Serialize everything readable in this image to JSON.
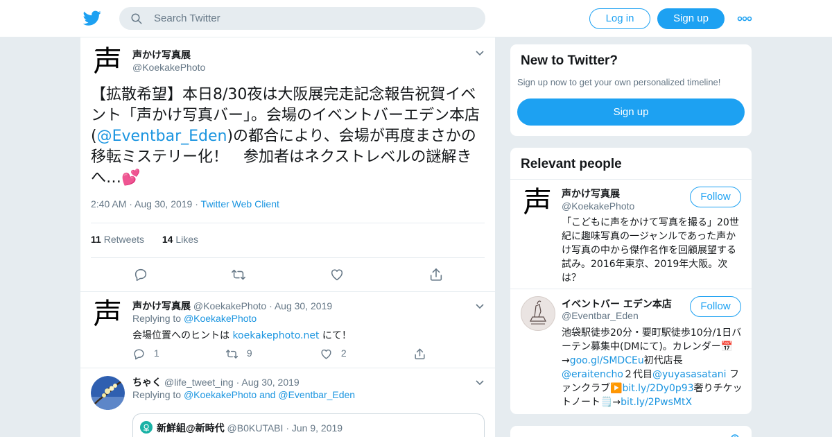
{
  "header": {
    "search_placeholder": "Search Twitter",
    "login_label": "Log in",
    "signup_label": "Sign up"
  },
  "main_tweet": {
    "name": "声かけ写真展",
    "handle": "@KoekakePhoto",
    "avatar_glyph": "声",
    "text_a": "【拡散希望】本日8/30夜は大阪展完走記念報告祝賀イベント「声かけ写真バー」。会場のイベントバーエデン本店(",
    "mention": "@Eventbar_Eden",
    "text_b": ")の都合により、会場が再度まさかの移転ミステリー化！　参加者はネクストレベルの謎解きへ…💕",
    "time": "2:40 AM",
    "date": "Aug 30, 2019",
    "client": "Twitter Web Client",
    "retweets_count": "11",
    "retweets_label": "Retweets",
    "likes_count": "14",
    "likes_label": "Likes"
  },
  "reply1": {
    "name": "声かけ写真展",
    "handle": "@KoekakePhoto",
    "date": "Aug 30, 2019",
    "avatar_glyph": "声",
    "replying_label": "Replying to",
    "replying_to": "@KoekakePhoto",
    "text_a": "会場位置へのヒントは ",
    "link": "koekakephoto.net",
    "text_b": " にて！",
    "replies": "1",
    "retweets": "9",
    "likes": "2"
  },
  "reply2": {
    "name": "ちゃく",
    "handle": "@life_tweet_ing",
    "date": "Aug 30, 2019",
    "replying_label": "Replying to",
    "replying_to": "@KoekakePhoto and @Eventbar_Eden",
    "quote_name": "新鮮組@新時代",
    "quote_handle": "@B0KUTABI",
    "quote_date": "Jun 9, 2019"
  },
  "new_to_twitter": {
    "title": "New to Twitter?",
    "subtitle": "Sign up now to get your own personalized timeline!",
    "signup_label": "Sign up"
  },
  "relevant_people": {
    "title": "Relevant people",
    "people": [
      {
        "name": "声かけ写真展",
        "handle": "@KoekakePhoto",
        "avatar_glyph": "声",
        "follow_label": "Follow",
        "bio": "「こどもに声をかけて写真を撮る」20世紀に趣味写真の一ジャンルであった声かけ写真の中から傑作名作を回顧展望する試み。2016年東京、2019年大阪。次は？"
      },
      {
        "name": "イベントバー エデン本店",
        "handle": "@Eventbar_Eden",
        "follow_label": "Follow",
        "bio_a": "池袋駅徒歩20分・要町駅徒歩10分/1日バーテン募集中(DMにて)。カレンダー📅→",
        "bio_link1": "goo.gl/SMDCEu",
        "bio_b": "初代店長",
        "bio_link2": "@eraitencho",
        "bio_c": "２代目",
        "bio_link3": "@yuyasasatani",
        "bio_d": " ファンクラブ▶️",
        "bio_link4": "bit.ly/2Dy0p93",
        "bio_e": "奢りチケットノート🗒️→",
        "bio_link5": "bit.ly/2PwsMtX"
      }
    ]
  },
  "colors": {
    "accent": "#1da1f2",
    "link": "#1b95e0",
    "heart": "#e0245e",
    "muted": "#657786",
    "background": "#e6ecf0"
  }
}
